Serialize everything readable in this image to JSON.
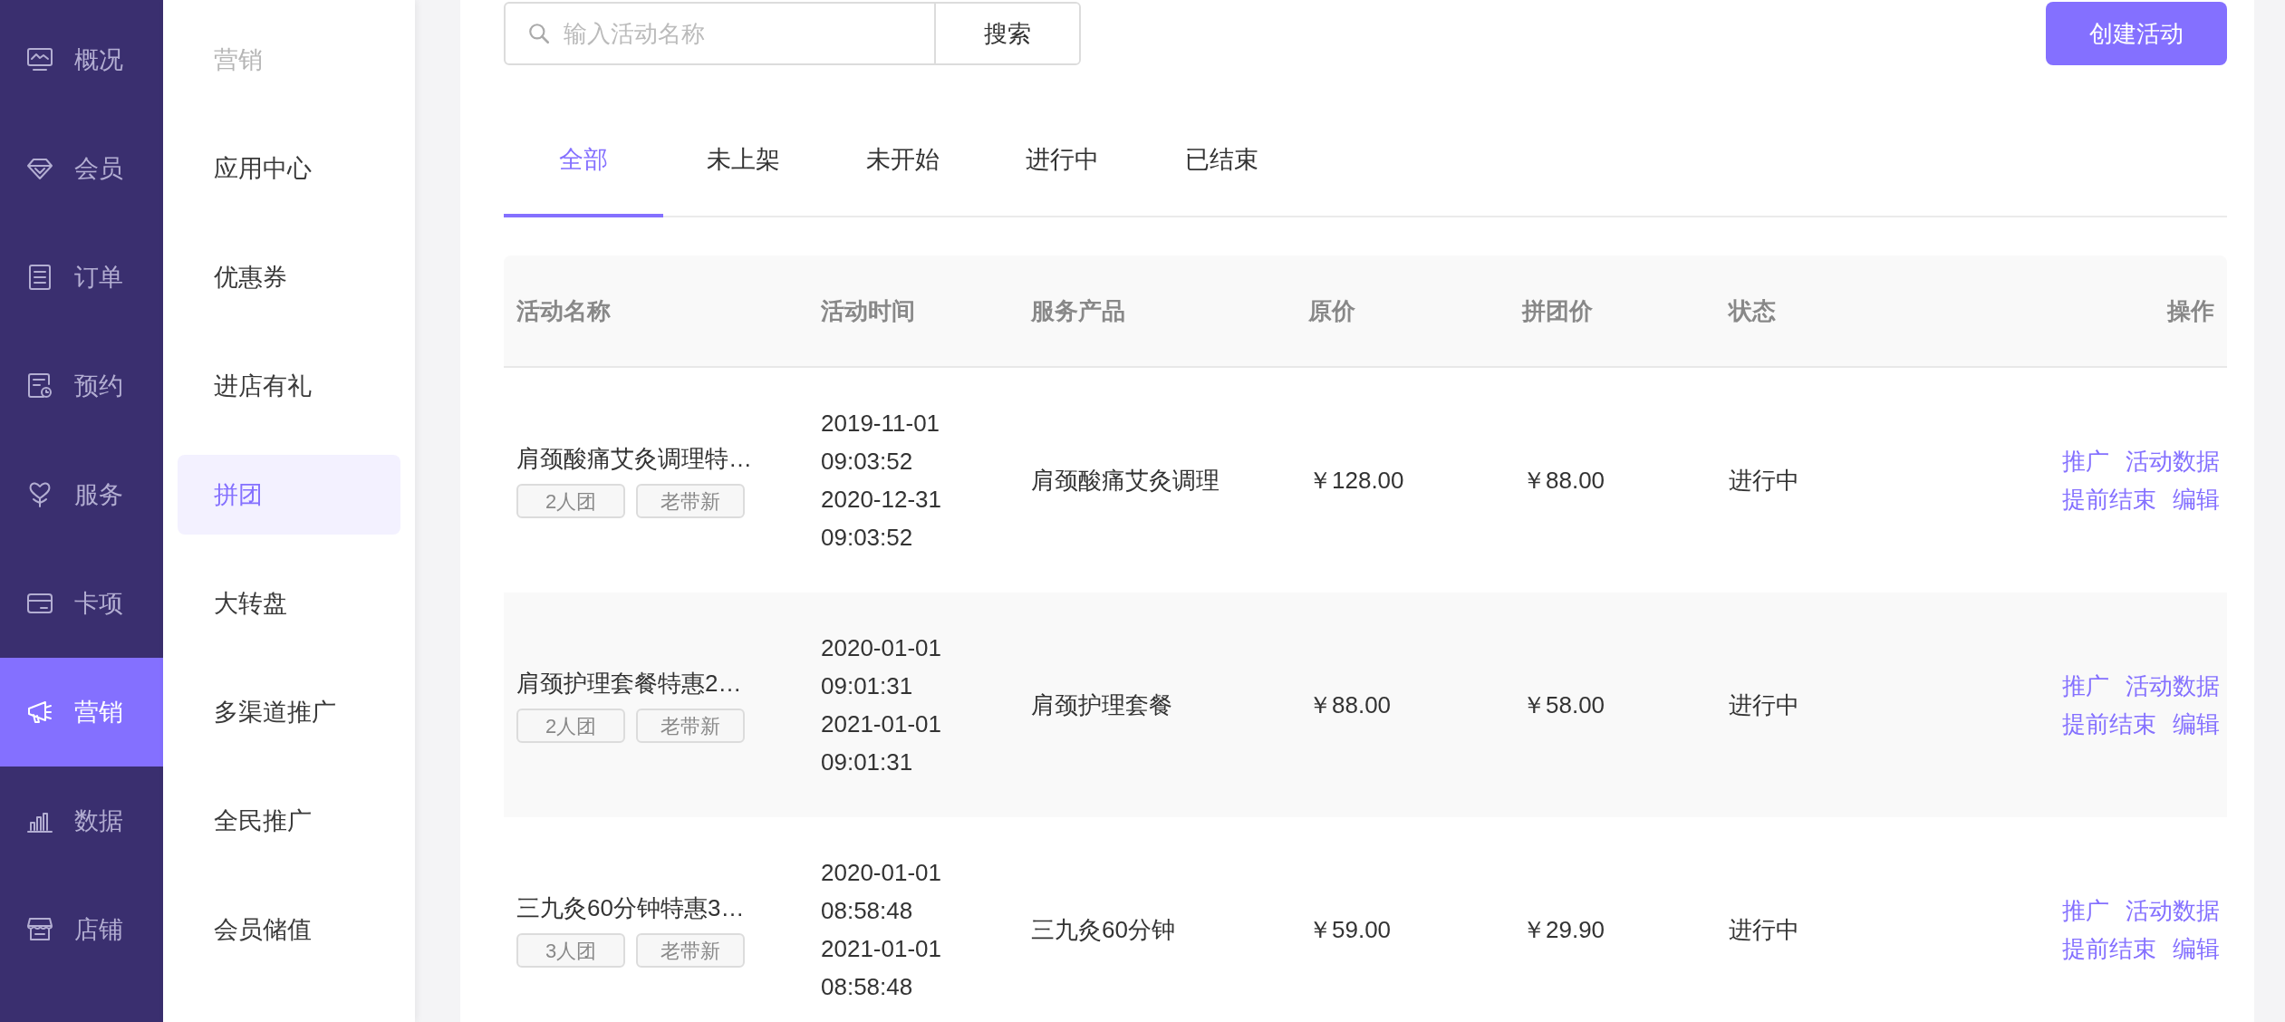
{
  "nav": [
    {
      "label": "概况",
      "selected": false
    },
    {
      "label": "会员",
      "selected": false
    },
    {
      "label": "订单",
      "selected": false
    },
    {
      "label": "预约",
      "selected": false
    },
    {
      "label": "服务",
      "selected": false
    },
    {
      "label": "卡项",
      "selected": false
    },
    {
      "label": "营销",
      "selected": true
    },
    {
      "label": "数据",
      "selected": false
    },
    {
      "label": "店铺",
      "selected": false
    }
  ],
  "subnav": {
    "heading": "营销",
    "items": [
      {
        "label": "应用中心",
        "selected": false
      },
      {
        "label": "优惠券",
        "selected": false
      },
      {
        "label": "进店有礼",
        "selected": false
      },
      {
        "label": "拼团",
        "selected": true
      },
      {
        "label": "大转盘",
        "selected": false
      },
      {
        "label": "多渠道推广",
        "selected": false
      },
      {
        "label": "全民推广",
        "selected": false
      },
      {
        "label": "会员储值",
        "selected": false
      }
    ]
  },
  "search": {
    "placeholder": "输入活动名称",
    "button": "搜索"
  },
  "create_button": "创建活动",
  "tabs": [
    {
      "label": "全部",
      "selected": true
    },
    {
      "label": "未上架",
      "selected": false
    },
    {
      "label": "未开始",
      "selected": false
    },
    {
      "label": "进行中",
      "selected": false
    },
    {
      "label": "已结束",
      "selected": false
    }
  ],
  "table": {
    "columns": [
      "活动名称",
      "活动时间",
      "服务产品",
      "原价",
      "拼团价",
      "状态",
      "操作"
    ],
    "rows": [
      {
        "name": "肩颈酸痛艾灸调理特…",
        "tags": [
          "2人团",
          "老带新"
        ],
        "time": [
          "2019-11-01",
          "09:03:52",
          "2020-12-31",
          "09:03:52"
        ],
        "product": "肩颈酸痛艾灸调理",
        "price": "￥128.00",
        "group_price": "￥88.00",
        "status": "进行中",
        "actions": [
          "推广",
          "活动数据",
          "提前结束",
          "编辑"
        ]
      },
      {
        "name": "肩颈护理套餐特惠2…",
        "tags": [
          "2人团",
          "老带新"
        ],
        "time": [
          "2020-01-01",
          "09:01:31",
          "2021-01-01",
          "09:01:31"
        ],
        "product": "肩颈护理套餐",
        "price": "￥88.00",
        "group_price": "￥58.00",
        "status": "进行中",
        "actions": [
          "推广",
          "活动数据",
          "提前结束",
          "编辑"
        ]
      },
      {
        "name": "三九灸60分钟特惠3…",
        "tags": [
          "3人团",
          "老带新"
        ],
        "time": [
          "2020-01-01",
          "08:58:48",
          "2021-01-01",
          "08:58:48"
        ],
        "product": "三九灸60分钟",
        "price": "￥59.00",
        "group_price": "￥29.90",
        "status": "进行中",
        "actions": [
          "推广",
          "活动数据",
          "提前结束",
          "编辑"
        ]
      }
    ]
  }
}
